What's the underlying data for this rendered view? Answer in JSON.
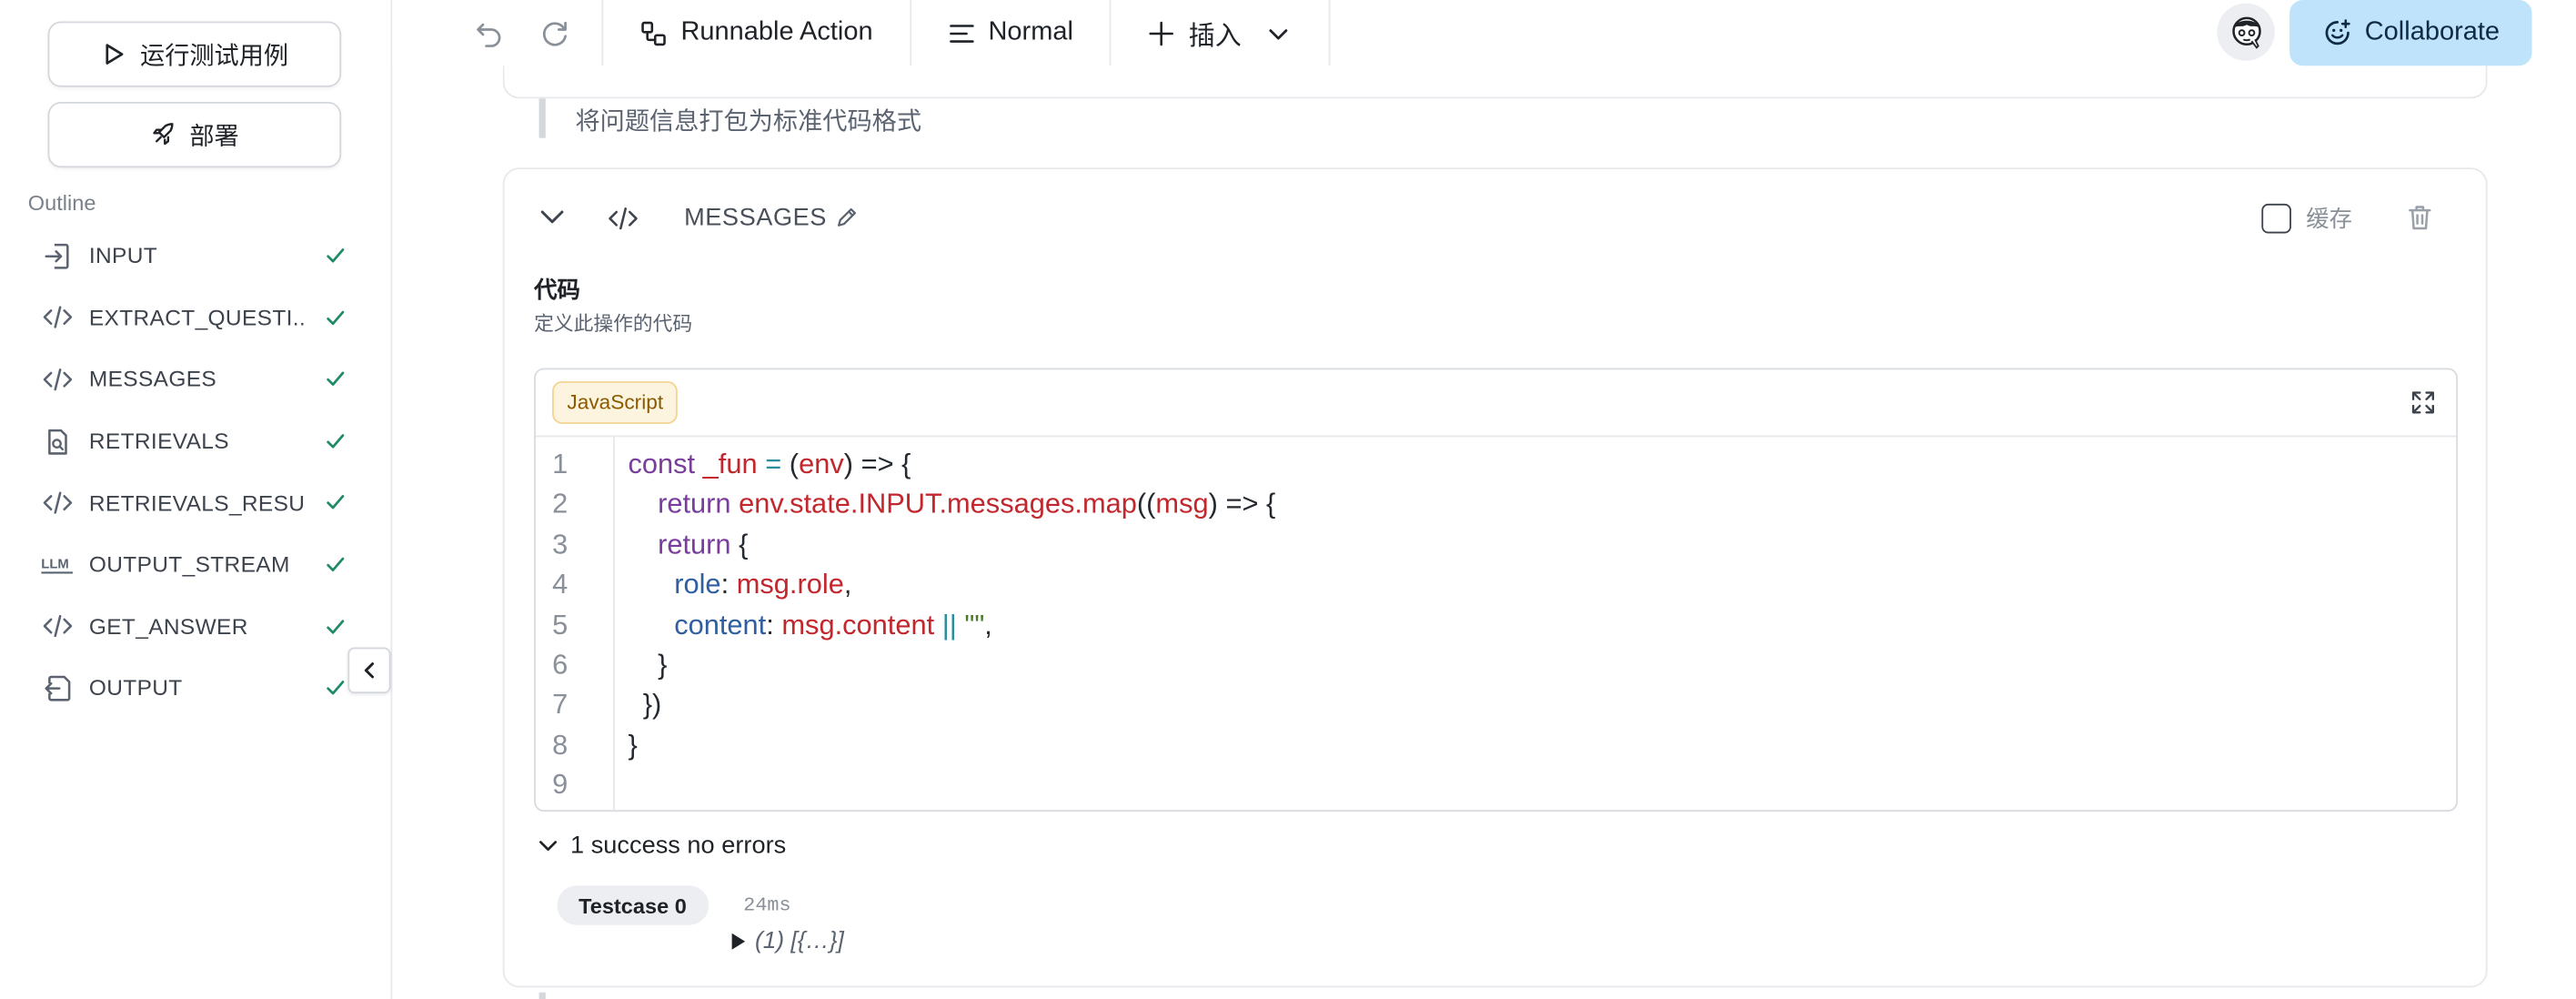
{
  "sidebar": {
    "run_tests_label": "运行测试用例",
    "deploy_label": "部署",
    "outline_title": "Outline",
    "items": [
      {
        "label": "INPUT",
        "icon": "input-icon"
      },
      {
        "label": "EXTRACT_QUESTI...",
        "icon": "code-icon"
      },
      {
        "label": "MESSAGES",
        "icon": "code-icon"
      },
      {
        "label": "RETRIEVALS",
        "icon": "retrieval-icon"
      },
      {
        "label": "RETRIEVALS_RESU...",
        "icon": "code-icon"
      },
      {
        "label": "OUTPUT_STREAM",
        "icon": "llm-icon"
      },
      {
        "label": "GET_ANSWER",
        "icon": "code-icon"
      },
      {
        "label": "OUTPUT",
        "icon": "output-icon"
      }
    ]
  },
  "toolbar": {
    "action_label": "Runnable Action",
    "style_label": "Normal",
    "insert_label": "插入",
    "collaborate_label": "Collaborate"
  },
  "main": {
    "prev_quote": "将问题信息打包为标准代码格式",
    "card": {
      "title": "MESSAGES",
      "cache_label": "缓存",
      "section_title": "代码",
      "section_desc": "定义此操作的代码",
      "language": "JavaScript",
      "line_numbers": [
        "1",
        "2",
        "3",
        "4",
        "5",
        "6",
        "7",
        "8",
        "9"
      ],
      "result_summary": "1 success no errors",
      "testcase_label": "Testcase 0",
      "testcase_time": "24ms",
      "testcase_output": "(1) [{…}]"
    }
  },
  "colors": {
    "accent": "#bfe3fb",
    "check": "#1f8a6a",
    "badge_bg": "#fdf4df"
  }
}
